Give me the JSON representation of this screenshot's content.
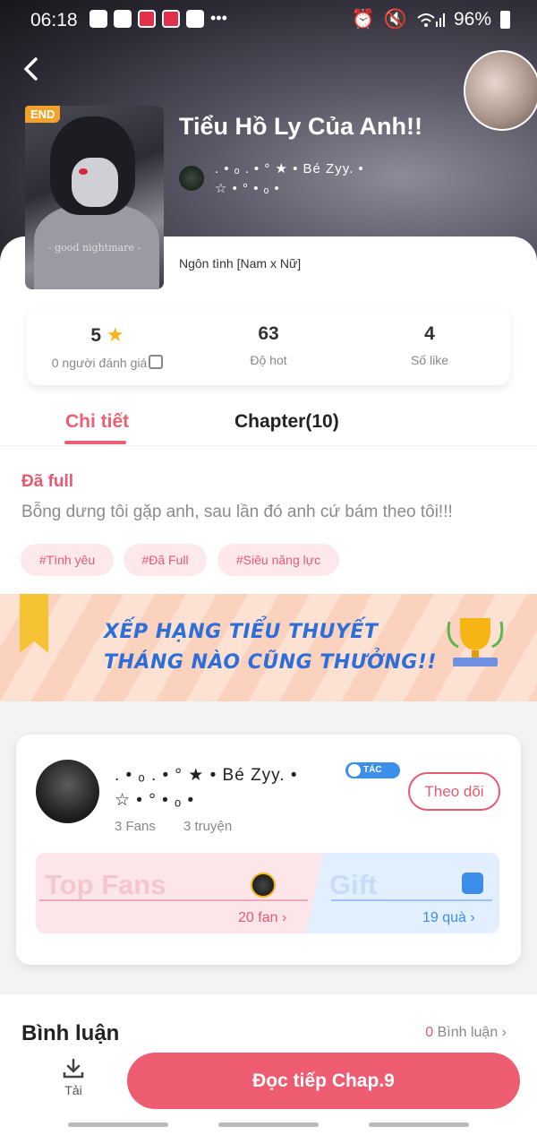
{
  "status_bar": {
    "time": "06:18",
    "battery": "96%"
  },
  "story": {
    "title": "Tiểu Hồ Ly Của Anh!!",
    "end_badge": "END",
    "cover_caption": "- good nightmare -",
    "author_line1": ". • ₒ . • ° ★ • Bé Zyy. •",
    "author_line2": "☆ • ° • ₒ •",
    "genre": "Ngôn tình [Nam x Nữ]"
  },
  "stats": {
    "rating_value": "5",
    "rating_label": "0 người đánh giá",
    "hot_value": "63",
    "hot_label": "Độ hot",
    "like_value": "4",
    "like_label": "Số like"
  },
  "tabs": {
    "detail": "Chi tiết",
    "chapters": "Chapter(10)"
  },
  "detail": {
    "status": "Đã full",
    "description": "Bỗng dưng tôi gặp anh, sau lần đó anh cứ bám theo tôi!!!",
    "tags": [
      "#Tình yêu",
      "#Đã Full",
      "#Siêu năng lực"
    ]
  },
  "banner": {
    "line1": "XẾP HẠNG TIỂU THUYẾT",
    "line2": "THÁNG NÀO CŨNG THƯỞNG!!"
  },
  "author_card": {
    "name_line1": ". • ₒ . • ° ★ • Bé Zyy. •",
    "name_line2": "☆ • ° • ₒ •",
    "badge": "TÁC GIẢ",
    "fans": "3 Fans",
    "stories": "3 truyện",
    "follow_label": "Theo dõi",
    "top_fans_label": "Top Fans",
    "fan_count": "20 fan",
    "gift_label": "Gift",
    "gift_count": "19 quà"
  },
  "comments": {
    "title": "Bình luận",
    "count": "0",
    "count_label": "Bình luận"
  },
  "bottom": {
    "download_label": "Tải",
    "read_label": "Đọc tiếp Chap.9"
  },
  "colors": {
    "accent": "#ee5c72",
    "blue": "#3b8ee9",
    "star": "#f5b515"
  }
}
